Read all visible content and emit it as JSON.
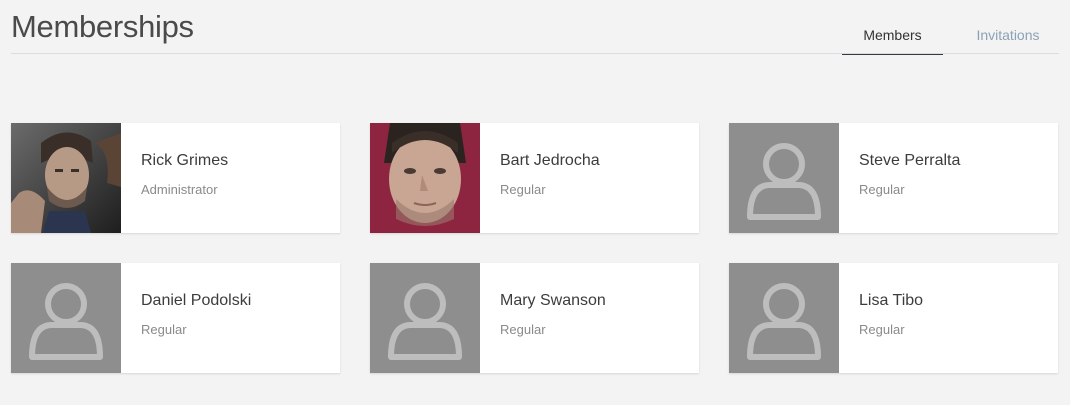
{
  "page": {
    "title": "Memberships"
  },
  "tabs": [
    {
      "label": "Members",
      "active": true
    },
    {
      "label": "Invitations",
      "active": false
    }
  ],
  "members": [
    {
      "name": "Rick Grimes",
      "role": "Administrator",
      "avatar": "photo-rick"
    },
    {
      "name": "Bart Jedrocha",
      "role": "Regular",
      "avatar": "photo-bart"
    },
    {
      "name": "Steve Perralta",
      "role": "Regular",
      "avatar": "placeholder-user-icon"
    },
    {
      "name": "Daniel Podolski",
      "role": "Regular",
      "avatar": "placeholder-user-icon"
    },
    {
      "name": "Mary Swanson",
      "role": "Regular",
      "avatar": "placeholder-user-icon"
    },
    {
      "name": "Lisa Tibo",
      "role": "Regular",
      "avatar": "placeholder-user-icon"
    }
  ],
  "colors": {
    "background": "#f3f3f3",
    "active_tab": "#333333",
    "inactive_tab": "#8ba2b6",
    "placeholder_bg": "#8e8e8e"
  }
}
